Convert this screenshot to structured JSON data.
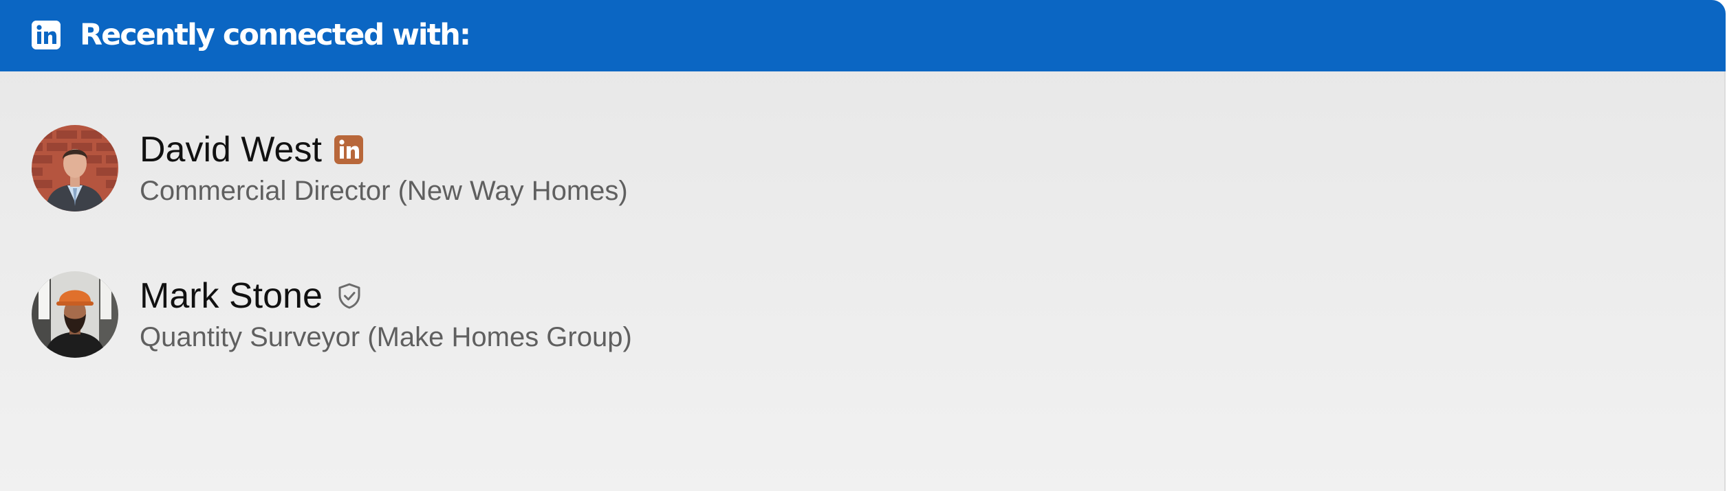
{
  "header": {
    "title": "Recently connected with:",
    "icon": "linkedin-icon",
    "background_color": "#0b66c3"
  },
  "connections": [
    {
      "name": "David West",
      "title": "Commercial Director (New Way Homes)",
      "badge_icon": "linkedin-icon",
      "badge_color": "#b8673a"
    },
    {
      "name": "Mark Stone",
      "title": "Quantity Surveyor (Make Homes Group)",
      "badge_icon": "verified-shield-icon",
      "badge_color": "#6b6b6b"
    }
  ]
}
